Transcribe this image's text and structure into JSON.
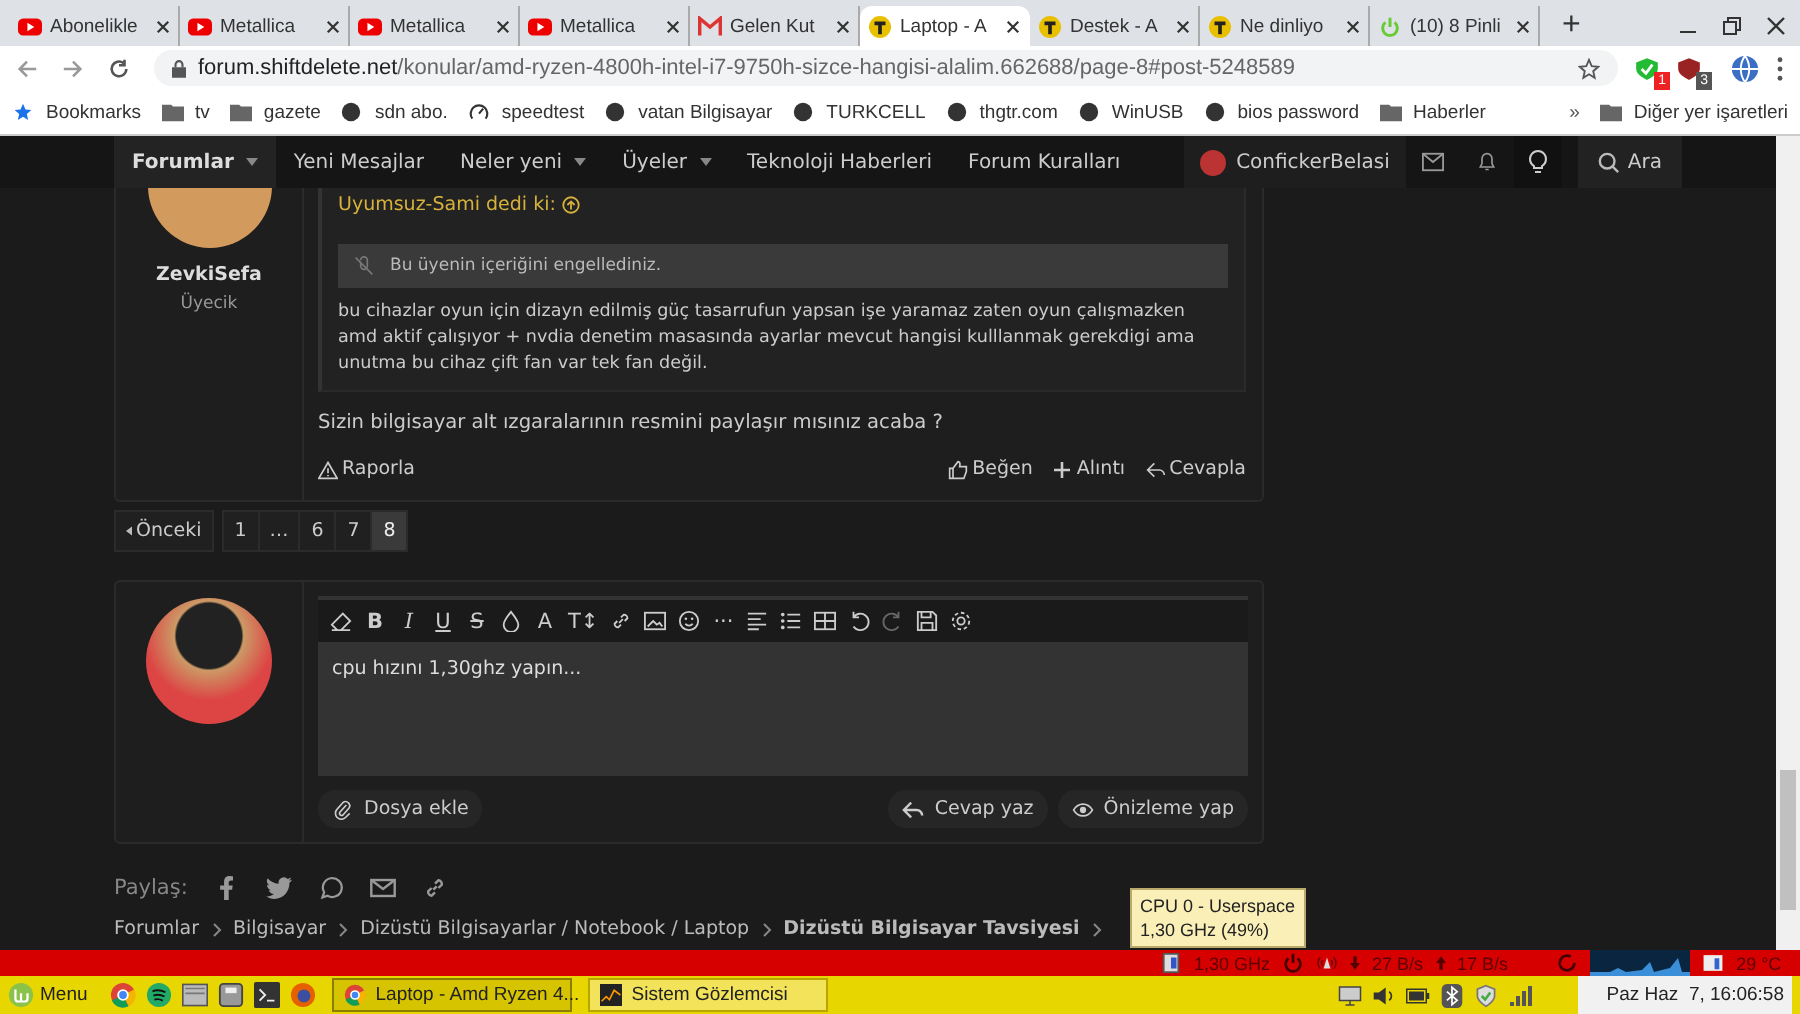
{
  "browser": {
    "tabs": [
      {
        "title": "Abonelikle",
        "kind": "video",
        "selected": false
      },
      {
        "title": "Metallica",
        "kind": "video",
        "selected": false
      },
      {
        "title": "Metallica",
        "kind": "video",
        "selected": false
      },
      {
        "title": "Metallica",
        "kind": "video",
        "selected": false
      },
      {
        "title": "Gelen Kut",
        "kind": "mail",
        "selected": false
      },
      {
        "title": "Laptop - A",
        "kind": "forum",
        "selected": true
      },
      {
        "title": "Destek - A",
        "kind": "forum",
        "selected": false
      },
      {
        "title": "Ne dinliyo",
        "kind": "forum",
        "selected": false
      },
      {
        "title": "(10) 8 Pinli",
        "kind": "power",
        "selected": false
      }
    ],
    "new_tab": "+",
    "address": {
      "domain": "forum.shiftdelete.net",
      "path": "/konular/amd-ryzen-4800h-intel-i7-9750h-sizce-hangisi-alalim.662688/page-8#post-5248589"
    },
    "extension_badges": [
      "1",
      "3"
    ],
    "bookmarks": [
      {
        "label": "Bookmarks",
        "kind": "star"
      },
      {
        "label": "tv",
        "kind": "folder"
      },
      {
        "label": "gazete",
        "kind": "folder"
      },
      {
        "label": "sdn abo.",
        "kind": "site"
      },
      {
        "label": "speedtest",
        "kind": "gauge"
      },
      {
        "label": "vatan Bilgisayar",
        "kind": "site"
      },
      {
        "label": "TURKCELL",
        "kind": "site"
      },
      {
        "label": "thgtr.com",
        "kind": "site"
      },
      {
        "label": "WinUSB",
        "kind": "site"
      },
      {
        "label": "bios password",
        "kind": "site"
      },
      {
        "label": "Haberler",
        "kind": "folder"
      }
    ],
    "more": "»",
    "other_bookmarks": "Diğer yer işaretleri"
  },
  "nav": {
    "items": [
      {
        "label": "Forumlar",
        "selected": true,
        "dropdown": true
      },
      {
        "label": "Yeni Mesajlar",
        "selected": false,
        "dropdown": false
      },
      {
        "label": "Neler yeni",
        "selected": false,
        "dropdown": true
      },
      {
        "label": "Üyeler",
        "selected": false,
        "dropdown": true
      },
      {
        "label": "Teknoloji Haberleri",
        "selected": false,
        "dropdown": false
      },
      {
        "label": "Forum Kuralları",
        "selected": false,
        "dropdown": false
      }
    ],
    "user": "ConfickerBelasi",
    "search": "Ara"
  },
  "post": {
    "author": "ZevkiSefa",
    "role": "Üyecik",
    "quote": {
      "author": "Uyumsuz-Sami dedi ki:",
      "blocked": "Bu üyenin içeriğini engellediniz.",
      "text": "bu cihazlar oyun için dizayn edilmiş güç tasarrufun yapsan işe yaramaz zaten oyun çalışmazken amd aktif çalışıyor + nvdia denetim masasında ayarlar mevcut hangisi kulllanmak gerekdigi ama unutma bu cihaz çift fan var tek fan değil."
    },
    "body": "Sizin bilgisayar alt ızgaralarının resmini paylaşır mısınız acaba ?",
    "report": "Raporla",
    "like": "Beğen",
    "quote_action": "Alıntı",
    "reply": "Cevapla"
  },
  "pagination": {
    "prev": "Önceki",
    "pages": [
      {
        "label": "1",
        "selected": false
      },
      {
        "label": "…",
        "selected": false
      },
      {
        "label": "6",
        "selected": false
      },
      {
        "label": "7",
        "selected": false
      },
      {
        "label": "8",
        "selected": true
      }
    ]
  },
  "editor": {
    "format_glyphs": [
      "B",
      "I",
      "U",
      "S",
      "A",
      "T↕"
    ],
    "more_glyph": "···",
    "value": "cpu hızını 1,30ghz yapın...",
    "attach": "Dosya ekle",
    "submit": "Cevap yaz",
    "preview": "Önizleme yap"
  },
  "share": {
    "label": "Paylaş:"
  },
  "breadcrumbs": [
    {
      "label": "Forumlar",
      "current": false
    },
    {
      "label": "Bilgisayar",
      "current": false
    },
    {
      "label": "Dizüstü Bilgisayarlar / Notebook / Laptop",
      "current": false
    },
    {
      "label": "Dizüstü Bilgisayar Tavsiyesi",
      "current": true
    }
  ],
  "tooltip": [
    "CPU 0 - Userspace",
    "1,30 GHz (49%)"
  ],
  "panel": {
    "cpu": "1,30 GHz",
    "down": "27 B/s",
    "up": "17 B/s",
    "temp": "29 °C"
  },
  "taskbar": {
    "menu": "Menu",
    "windows": [
      {
        "label": "Laptop - Amd Ryzen 4...",
        "selected": true
      },
      {
        "label": "Sistem Gözlemcisi",
        "selected": false
      }
    ],
    "clock": "Paz Haz  7, 16:06:58"
  }
}
